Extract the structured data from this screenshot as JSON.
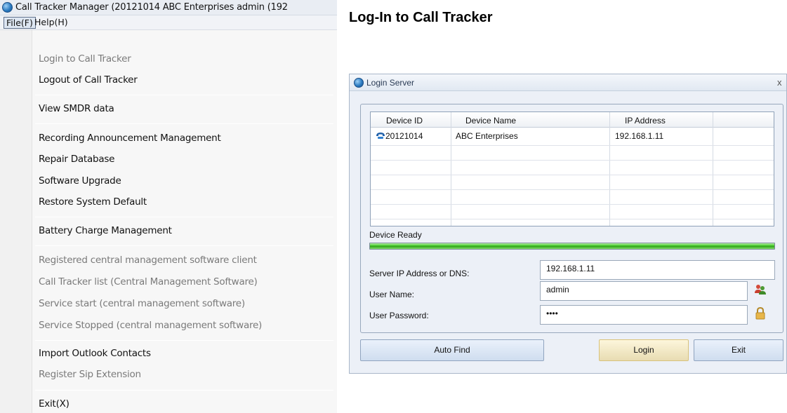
{
  "app": {
    "title": "Call Tracker Manager (20121014 ABC Enterprises admin (192",
    "menubar": {
      "file": "File(F)",
      "help": "Help(H)"
    }
  },
  "file_menu": {
    "items": [
      {
        "label": "Login to Call Tracker",
        "enabled": false
      },
      {
        "label": "Logout of Call Tracker",
        "enabled": true
      },
      {
        "label": "View SMDR data",
        "enabled": true
      },
      {
        "label": "Recording Announcement Management",
        "enabled": true
      },
      {
        "label": "Repair Database",
        "enabled": true
      },
      {
        "label": "Software Upgrade",
        "enabled": true
      },
      {
        "label": "Restore System Default",
        "enabled": true
      },
      {
        "label": "Battery Charge Management",
        "enabled": true
      },
      {
        "label": "Registered central management software client",
        "enabled": false
      },
      {
        "label": "Call Tracker list (Central Management Software)",
        "enabled": false
      },
      {
        "label": "Service start (central management software)",
        "enabled": false
      },
      {
        "label": "Service Stopped (central management software)",
        "enabled": false
      },
      {
        "label": "Import Outlook Contacts",
        "enabled": true
      },
      {
        "label": "Register Sip Extension",
        "enabled": false
      },
      {
        "label": "Exit(X)",
        "enabled": true
      }
    ]
  },
  "heading": "Log-In to Call Tracker",
  "dialog": {
    "title": "Login Server",
    "close_glyph": "x",
    "table": {
      "columns": [
        "Device ID",
        "Device Name",
        "IP Address"
      ],
      "rows": [
        {
          "device_id": "20121014",
          "device_name": "ABC Enterprises",
          "ip_address": "192.168.1.11"
        }
      ]
    },
    "status": "Device Ready",
    "progress": 1.0,
    "fields": {
      "server": {
        "label": "Server IP Address or DNS:",
        "value": "192.168.1.11"
      },
      "user": {
        "label": "User Name:",
        "value": "admin"
      },
      "password": {
        "label": "User Password:",
        "value": "••••"
      }
    },
    "buttons": {
      "auto_find": "Auto Find",
      "login": "Login",
      "exit": "Exit"
    },
    "icons": {
      "device": "phone-icon",
      "user": "users-icon",
      "password": "lock-icon"
    }
  },
  "colors": {
    "progress": "#3fc426",
    "accent": "#2c7cc2"
  }
}
